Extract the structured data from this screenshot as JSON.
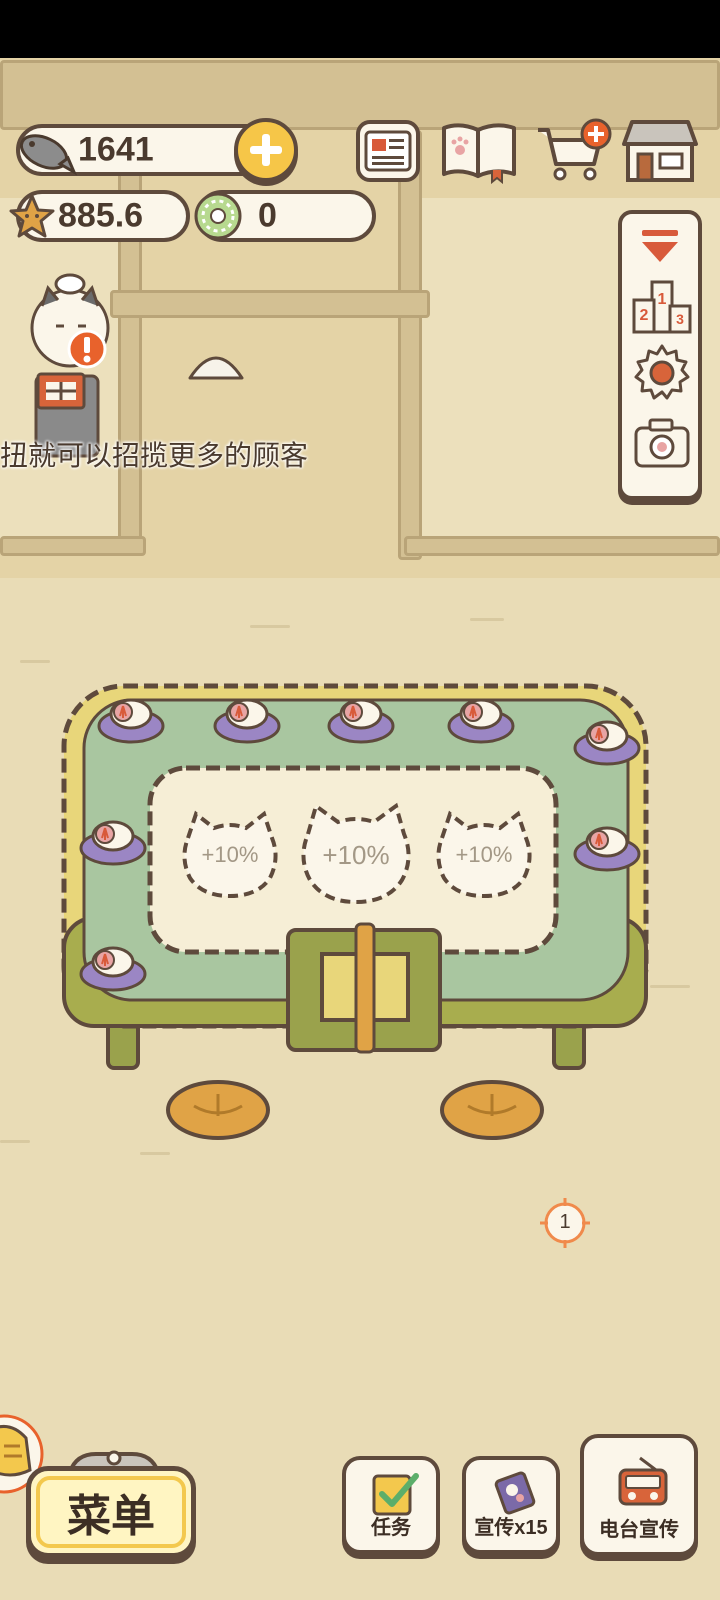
{
  "currency": {
    "fish": "1641",
    "stars": "885.6",
    "gems": "0"
  },
  "hint": {
    "text": "扭就可以招揽更多的顾客"
  },
  "table": {
    "seat_bonus": [
      "+10%",
      "+10%",
      "+10%"
    ]
  },
  "map_marker": {
    "number": "1"
  },
  "bottom_bar": {
    "menu_label": "菜单",
    "tasks_label": "任务",
    "promote_label": "宣传x15",
    "radio_label": "电台宣传"
  },
  "colors": {
    "outline": "#5e4a3c",
    "panel": "#fbf6ea",
    "accent_yellow": "#f3c84d",
    "alert_orange": "#e8622c",
    "conveyor_green": "#a9c6a0",
    "table_frame": "#e8d67a"
  }
}
